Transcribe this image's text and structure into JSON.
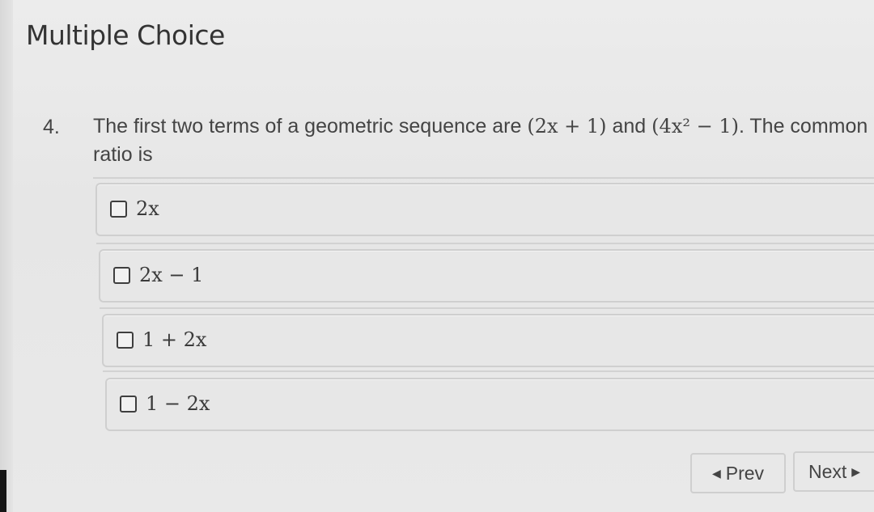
{
  "section": {
    "title": "Multiple Choice"
  },
  "question": {
    "number": "4.",
    "text_before": "The first two terms of a geometric sequence are",
    "term1": "(2x + 1)",
    "and": "and",
    "term2": "(4x² − 1)",
    "text_after": ". The common ratio is"
  },
  "options": [
    {
      "label": "2x"
    },
    {
      "label": "2x − 1"
    },
    {
      "label": "1 + 2x"
    },
    {
      "label": "1 − 2x"
    }
  ],
  "nav": {
    "prev_label": "Prev",
    "next_label": "Next",
    "prev_icon": "triangle-left-icon",
    "next_icon": "triangle-right-icon"
  }
}
